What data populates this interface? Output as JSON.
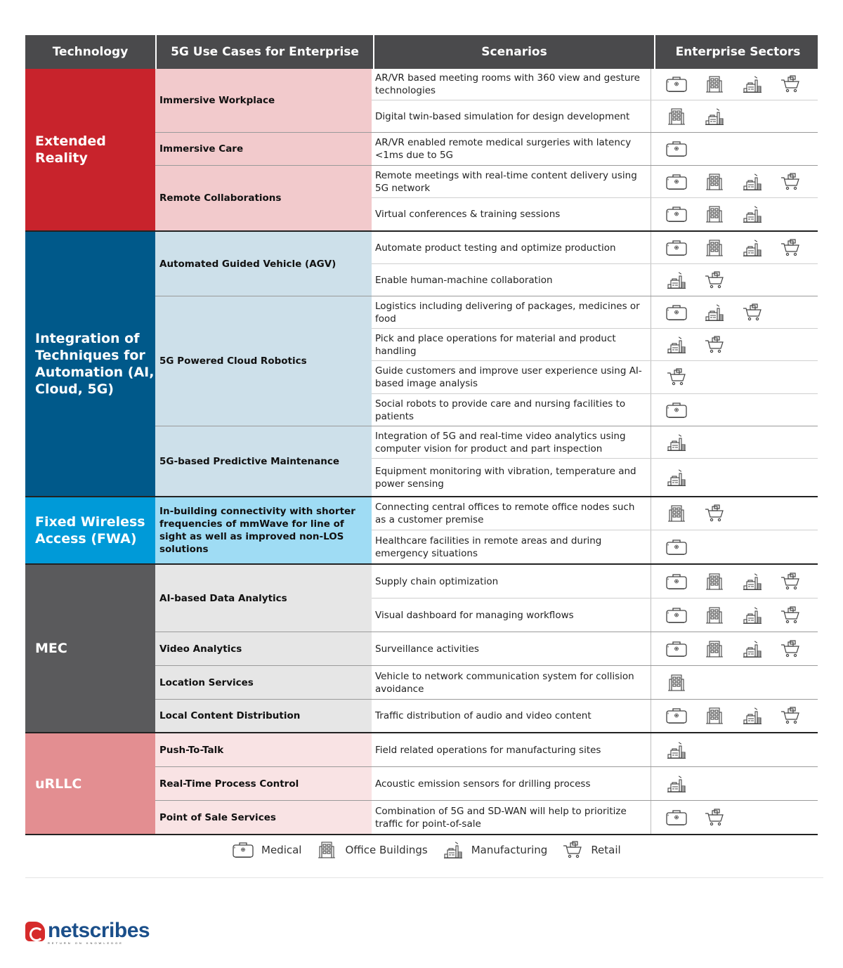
{
  "header": {
    "technology": "Technology",
    "use_cases": "5G Use Cases for Enterprise",
    "scenarios": "Scenarios",
    "sectors": "Enterprise Sectors"
  },
  "colors": {
    "header_bg": "#4a4a4c",
    "extended_reality": "#c8232c",
    "extended_reality_light": "#f2cacc",
    "automation": "#00598a",
    "automation_light": "#cde0ea",
    "fwa": "#009ad8",
    "fwa_light": "#9fdcf4",
    "mec": "#5a5a5c",
    "mec_light": "#e6e6e6",
    "urllc": "#e38e91",
    "urllc_light": "#f9e3e4",
    "icon_stroke": "#444444",
    "logo_red": "#d62b2b",
    "logo_blue": "#1b4f8a"
  },
  "groups": [
    {
      "technology": "Extended Reality",
      "use_cases": [
        {
          "name": "Immersive Workplace",
          "scenarios": [
            {
              "text": "AR/VR based meeting rooms with 360 view and gesture technologies",
              "sectors": [
                "medical",
                "office",
                "manufacturing",
                "retail"
              ]
            },
            {
              "text": "Digital twin-based simulation for design development",
              "sectors": [
                "office",
                "manufacturing"
              ]
            }
          ]
        },
        {
          "name": "Immersive Care",
          "scenarios": [
            {
              "text": "AR/VR enabled remote medical surgeries with latency <1ms due to 5G",
              "sectors": [
                "medical"
              ]
            }
          ]
        },
        {
          "name": "Remote Collaborations",
          "scenarios": [
            {
              "text": "Remote meetings with real-time content delivery using 5G network",
              "sectors": [
                "medical",
                "office",
                "manufacturing",
                "retail"
              ]
            },
            {
              "text": "Virtual conferences & training sessions",
              "sectors": [
                "medical",
                "office",
                "manufacturing"
              ]
            }
          ]
        }
      ]
    },
    {
      "technology": "Integration of Techniques for Automation (AI, Cloud, 5G)",
      "use_cases": [
        {
          "name": "Automated Guided Vehicle (AGV)",
          "scenarios": [
            {
              "text": "Automate product testing and optimize production",
              "sectors": [
                "medical",
                "office",
                "manufacturing",
                "retail"
              ]
            },
            {
              "text": "Enable human-machine collaboration",
              "sectors": [
                "manufacturing",
                "retail"
              ]
            }
          ]
        },
        {
          "name": "5G Powered Cloud Robotics",
          "scenarios": [
            {
              "text": "Logistics including delivering of packages, medicines or food",
              "sectors": [
                "medical",
                "manufacturing",
                "retail"
              ]
            },
            {
              "text": "Pick and place operations for material and product handling",
              "sectors": [
                "manufacturing",
                "retail"
              ]
            },
            {
              "text": "Guide customers and improve user experience using AI-based image analysis",
              "sectors": [
                "retail"
              ]
            },
            {
              "text": "Social robots to provide care and nursing facilities to patients",
              "sectors": [
                "medical"
              ]
            }
          ]
        },
        {
          "name": "5G-based Predictive Maintenance",
          "scenarios": [
            {
              "text": "Integration of 5G and real-time video analytics using computer vision for product and part inspection",
              "sectors": [
                "manufacturing"
              ]
            },
            {
              "text": "Equipment monitoring with vibration, temperature and power sensing",
              "sectors": [
                "manufacturing"
              ]
            }
          ]
        }
      ]
    },
    {
      "technology": "Fixed Wireless Access (FWA)",
      "use_cases": [
        {
          "name": "In-building connectivity with shorter frequencies of mmWave for line of sight as well as improved non-LOS solutions",
          "scenarios": [
            {
              "text": "Connecting central offices to remote office nodes such as a customer premise",
              "sectors": [
                "office",
                "retail"
              ]
            },
            {
              "text": "Healthcare facilities in remote areas and during emergency situations",
              "sectors": [
                "medical"
              ]
            }
          ]
        }
      ]
    },
    {
      "technology": "MEC",
      "use_cases": [
        {
          "name": "AI-based Data Analytics",
          "scenarios": [
            {
              "text": "Supply chain optimization",
              "sectors": [
                "medical",
                "office",
                "manufacturing",
                "retail"
              ]
            },
            {
              "text": "Visual dashboard for managing workflows",
              "sectors": [
                "medical",
                "office",
                "manufacturing",
                "retail"
              ]
            }
          ]
        },
        {
          "name": "Video Analytics",
          "scenarios": [
            {
              "text": "Surveillance activities",
              "sectors": [
                "medical",
                "office",
                "manufacturing",
                "retail"
              ]
            }
          ]
        },
        {
          "name": "Location Services",
          "scenarios": [
            {
              "text": "Vehicle to network communication system for collision avoidance",
              "sectors": [
                "office"
              ]
            }
          ]
        },
        {
          "name": "Local Content Distribution",
          "scenarios": [
            {
              "text": "Traffic distribution of audio and video content",
              "sectors": [
                "medical",
                "office",
                "manufacturing",
                "retail"
              ]
            }
          ]
        }
      ]
    },
    {
      "technology": "uRLLC",
      "use_cases": [
        {
          "name": "Push-To-Talk",
          "scenarios": [
            {
              "text": "Field related operations for manufacturing sites",
              "sectors": [
                "manufacturing"
              ]
            }
          ]
        },
        {
          "name": "Real-Time Process Control",
          "scenarios": [
            {
              "text": "Acoustic emission sensors for drilling process",
              "sectors": [
                "manufacturing"
              ]
            }
          ]
        },
        {
          "name": "Point of Sale Services",
          "scenarios": [
            {
              "text": "Combination of 5G and SD-WAN will help to prioritize traffic for point-of-sale",
              "sectors": [
                "medical",
                "retail"
              ]
            }
          ]
        }
      ]
    }
  ],
  "legend": [
    {
      "key": "medical",
      "icon": "medical-kit-icon",
      "label": "Medical"
    },
    {
      "key": "office",
      "icon": "office-building-icon",
      "label": "Office Buildings"
    },
    {
      "key": "manufacturing",
      "icon": "factory-icon",
      "label": "Manufacturing"
    },
    {
      "key": "retail",
      "icon": "shopping-cart-icon",
      "label": "Retail"
    }
  ],
  "logo": {
    "name": "netscribes",
    "tagline": "RETURN ON KNOWLEDGE"
  }
}
